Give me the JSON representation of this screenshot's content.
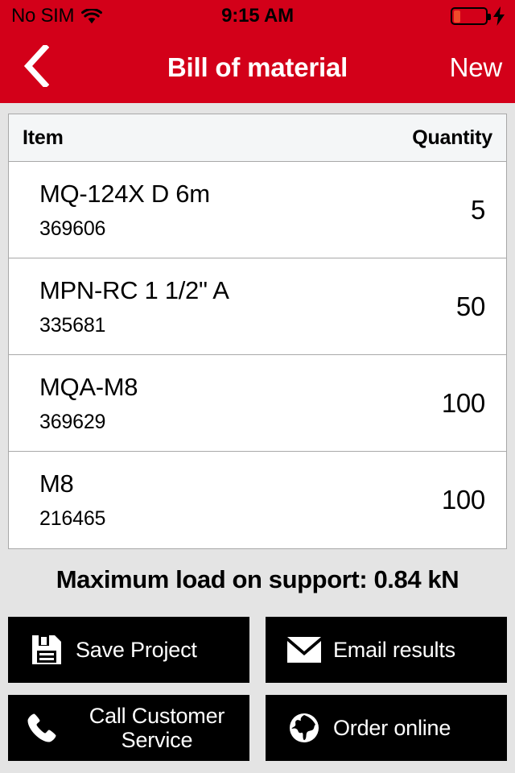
{
  "status_bar": {
    "carrier": "No SIM",
    "wifi_icon": "wifi-icon",
    "time": "9:15 AM",
    "battery_icon": "battery-icon",
    "battery_level_percent": 20,
    "charging_icon": "lightning-bolt-icon",
    "background_color": "#d30019",
    "text_color": "#000000"
  },
  "nav_bar": {
    "back_icon": "chevron-left-icon",
    "title": "Bill of material",
    "new_label": "New",
    "background_color": "#d30019",
    "text_color": "#ffffff"
  },
  "table": {
    "headers": {
      "item": "Item",
      "quantity": "Quantity"
    },
    "rows": [
      {
        "name": "MQ-124X D 6m",
        "code": "369606",
        "quantity": "5"
      },
      {
        "name": "MPN-RC 1 1/2\" A",
        "code": "335681",
        "quantity": "50"
      },
      {
        "name": "MQA-M8",
        "code": "369629",
        "quantity": "100"
      },
      {
        "name": "M8",
        "code": "216465",
        "quantity": "100"
      }
    ]
  },
  "summary": {
    "text": "Maximum load on support: 0.84 kN"
  },
  "actions": [
    {
      "label": "Save Project",
      "icon": "floppy-disk-icon"
    },
    {
      "label": "Email results",
      "icon": "envelope-icon"
    },
    {
      "label": "Call Customer\nService",
      "icon": "phone-icon"
    },
    {
      "label": "Order online",
      "icon": "globe-icon"
    }
  ]
}
